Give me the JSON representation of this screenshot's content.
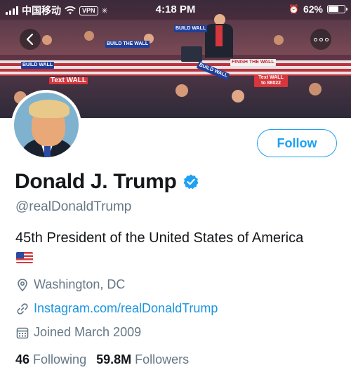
{
  "status_bar": {
    "carrier": "中国移动",
    "vpn_label": "VPN",
    "time": "4:18 PM",
    "battery": "62%",
    "battery_level": 0.62
  },
  "banner": {
    "signs": [
      "BUILD WALL",
      "BUILD THE WALL",
      "FINISH THE WALL",
      "Text WALL to 88022",
      "Text WALL",
      "BUILD WALL",
      "BUILD WALL"
    ]
  },
  "nav": {
    "back_icon": "chevron-left-icon",
    "more_icon": "more-horizontal-icon"
  },
  "profile": {
    "name": "Donald J. Trump",
    "verified_icon": "verified-badge-icon",
    "handle": "@realDonaldTrump",
    "bio": "45th President of the United States of America",
    "bio_emoji": "us-flag-emoji",
    "location": "Washington, DC",
    "website": "Instagram.com/realDonaldTrump",
    "joined": "Joined March 2009",
    "following_count": "46",
    "following_label": "Following",
    "followers_count": "59.8M",
    "followers_label": "Followers"
  },
  "actions": {
    "follow_label": "Follow"
  },
  "colors": {
    "accent": "#1da1f2",
    "link": "#1b95e0",
    "secondary_text": "#657786",
    "primary_text": "#14171a"
  }
}
